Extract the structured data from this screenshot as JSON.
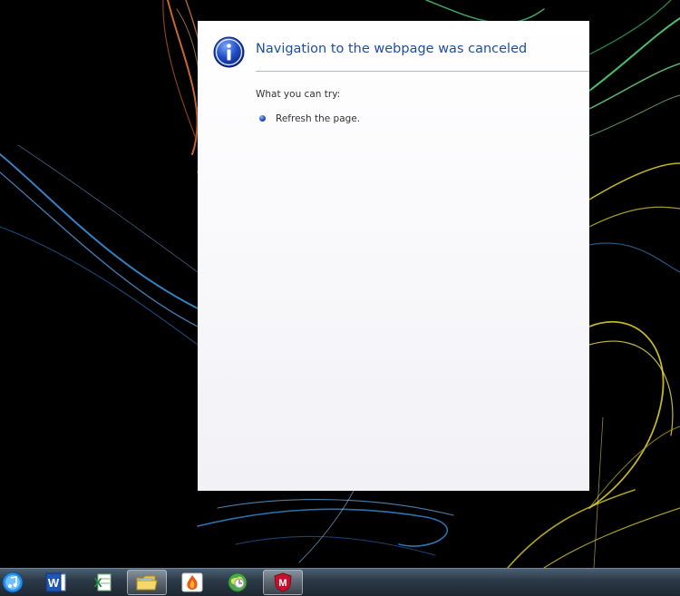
{
  "dialog": {
    "title": "Navigation to the webpage was canceled",
    "try_label": "What you can try:",
    "suggestions": [
      {
        "text": "Refresh the page."
      }
    ]
  },
  "taskbar": {
    "items": [
      {
        "name": "itunes"
      },
      {
        "name": "word",
        "glyph": "W"
      },
      {
        "name": "excel",
        "glyph": "X"
      },
      {
        "name": "windows-explorer",
        "active": true
      },
      {
        "name": "app-orange"
      },
      {
        "name": "app-globe"
      },
      {
        "name": "mcafee",
        "glyph": "M"
      }
    ]
  },
  "colors": {
    "title": "#1f4e9c",
    "taskbar": "#2c3a48",
    "wallpaper_orange": "#e0703a",
    "wallpaper_green": "#4fd07a",
    "wallpaper_blue": "#3a8fd8",
    "wallpaper_yellow": "#d6c92c"
  }
}
